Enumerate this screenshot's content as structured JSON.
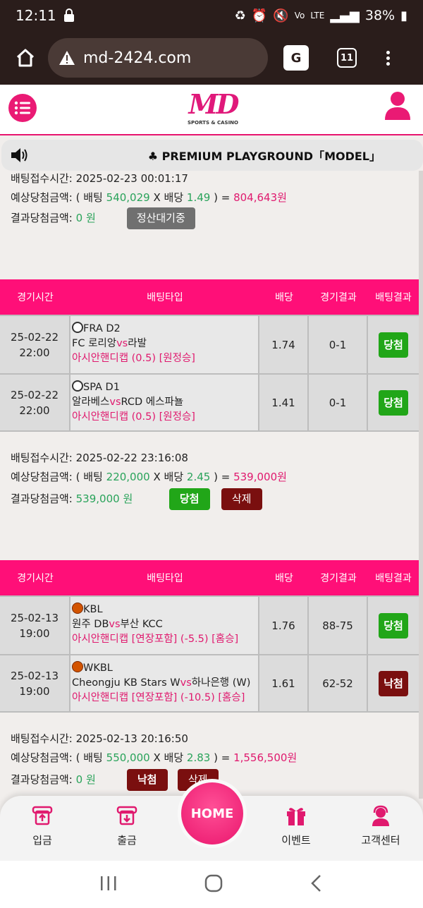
{
  "status_bar": {
    "time": "12:11",
    "battery": "38%",
    "network": "LTE"
  },
  "browser": {
    "url": "md-2424.com",
    "tab_count": "11"
  },
  "site": {
    "logo_text": "MD",
    "logo_sub": "SPORTS & CASINO"
  },
  "notice": {
    "text": "♣ PREMIUM PLAYGROUND「MODEL」"
  },
  "labels": {
    "bet_time": "배팅접수시간:",
    "expected": "예상당첨금액:",
    "result": "결과당첨금액:",
    "col_time": "경기시간",
    "col_type": "배팅타입",
    "col_odds": "배당",
    "col_score": "경기결과",
    "col_result": "배팅결과"
  },
  "summary_top": {
    "time": "2025-02-23 00:01:17",
    "stake": "540,029",
    "odds": "1.49",
    "payout": "804,643원",
    "result_amount": "0 원",
    "status_button": "정산대기중"
  },
  "bet2": {
    "rows": [
      {
        "date": "25-02-22",
        "hour": "22:00",
        "league": "FRA D2",
        "home": "FC 로리앙",
        "away": "라발",
        "market": "아시안핸디캡 (0.5) [원정승]",
        "odds": "1.74",
        "score": "0-1",
        "result": "당첨"
      },
      {
        "date": "25-02-22",
        "hour": "22:00",
        "league": "SPA D1",
        "home": "알라베스",
        "away": "RCD 에스파뇰",
        "market": "아시안핸디캡 (0.5) [원정승]",
        "odds": "1.41",
        "score": "0-1",
        "result": "당첨"
      }
    ],
    "time": "2025-02-22 23:16:08",
    "stake": "220,000",
    "odds": "2.45",
    "payout": "539,000원",
    "result_amount": "539,000 원",
    "result_button": "당첨",
    "delete_button": "삭제"
  },
  "bet3": {
    "rows": [
      {
        "date": "25-02-13",
        "hour": "19:00",
        "league": "KBL",
        "home": "원주 DB",
        "away": "부산 KCC",
        "market": "아시안핸디캡 [연장포함] (-5.5) [홈승]",
        "odds": "1.76",
        "score": "88-75",
        "result": "당첨"
      },
      {
        "date": "25-02-13",
        "hour": "19:00",
        "league": "WKBL",
        "home": "Cheongju KB Stars W",
        "away": "하나은행 (W)",
        "market": "아시안핸디캡 [연장포함] (-10.5) [홈승]",
        "odds": "1.61",
        "score": "62-52",
        "result": "낙첨"
      }
    ],
    "time": "2025-02-13 20:16:50",
    "stake": "550,000",
    "odds": "2.83",
    "payout": "1,556,500원",
    "result_amount": "0 원",
    "result_button": "낙첨",
    "delete_button": "삭제"
  },
  "text": {
    "expected_open": "( 배팅",
    "x_odds": "X 배당",
    "eq": ") =",
    "vs": "vs"
  },
  "bottom_nav": {
    "deposit": "입금",
    "withdraw": "출금",
    "home": "HOME",
    "event": "이벤트",
    "support": "고객센터"
  },
  "colors": {
    "brand_pink": "#ff0f78",
    "win_green": "#21a618",
    "lose_red": "#7a0f0f",
    "amount_green": "#29a35a"
  }
}
